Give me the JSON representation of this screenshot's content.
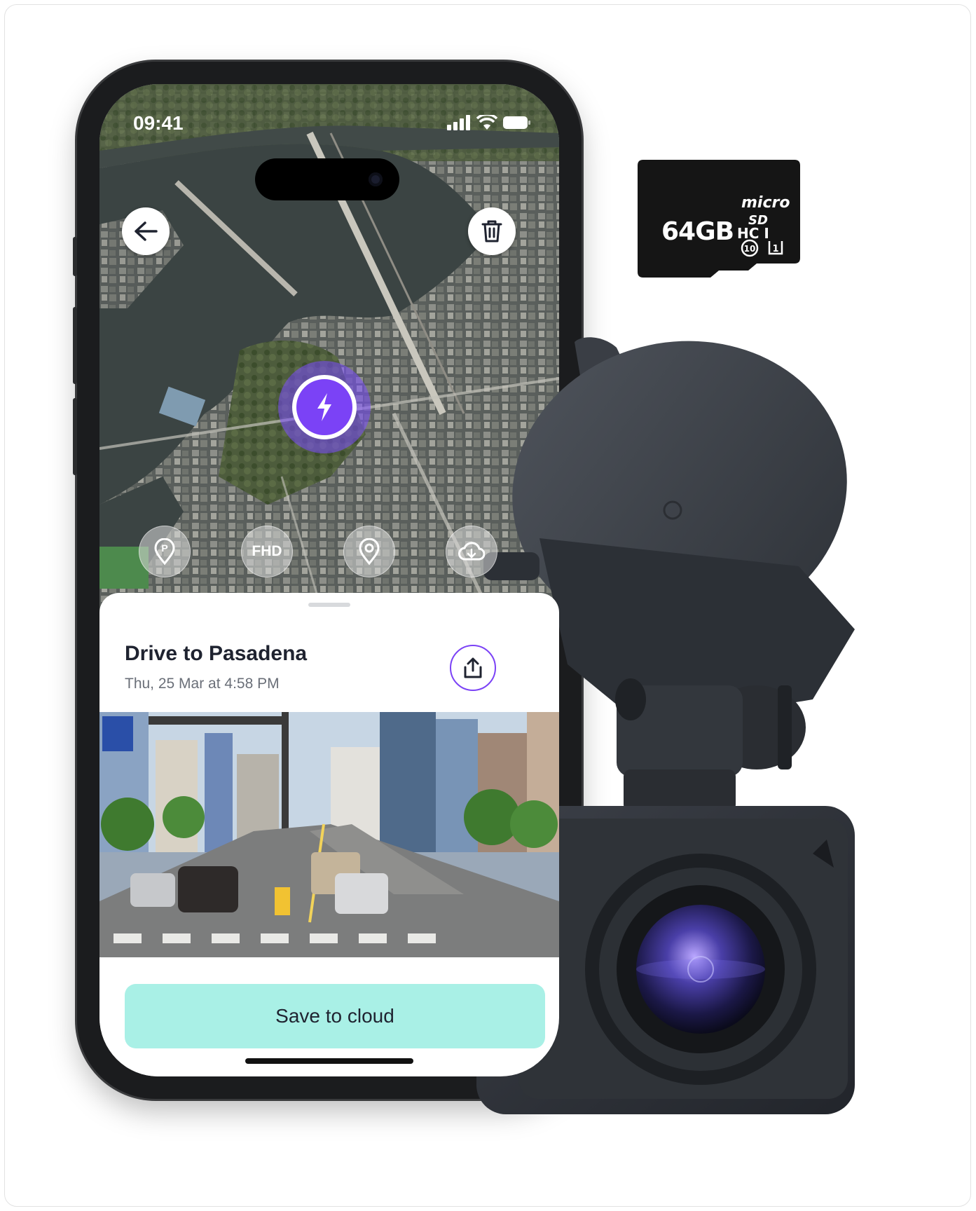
{
  "phone": {
    "status_bar": {
      "time": "09:41"
    },
    "map": {
      "buttons": [
        {
          "id": "parking",
          "label": ""
        },
        {
          "id": "quality",
          "label": "FHD"
        },
        {
          "id": "location",
          "label": ""
        },
        {
          "id": "cloud-download",
          "label": ""
        }
      ]
    },
    "trip": {
      "title": "Drive to Pasadena",
      "date": "Thu, 25 Mar at 4:58 PM"
    },
    "save_button": "Save to cloud"
  },
  "sd_card": {
    "capacity": "64GB",
    "brand": "micro SD HC I",
    "class_marks": [
      "10",
      "1"
    ]
  },
  "colors": {
    "accent": "#7b42f6",
    "save_button_bg": "#a9f0e6",
    "phone_frame": "#1b1c1e"
  }
}
